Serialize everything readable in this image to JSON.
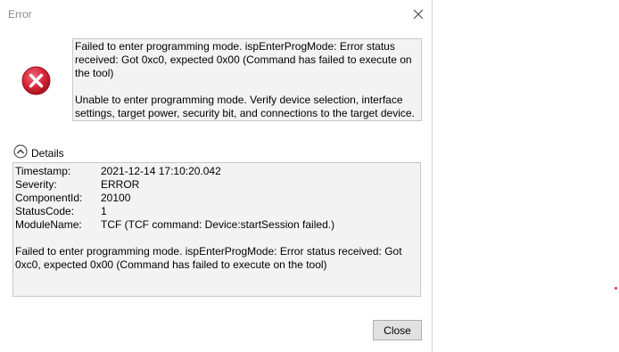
{
  "window": {
    "title": "Error"
  },
  "message": {
    "line1": "Failed to enter programming mode. ispEnterProgMode: Error status received: Got 0xc0, expected 0x00 (Command has failed to execute on the tool)",
    "line2": "Unable to enter programming mode. Verify device selection, interface settings, target power, security bit, and connections to the target device."
  },
  "details": {
    "toggle_label": "Details",
    "expanded": true,
    "fields": [
      {
        "key": "Timestamp:",
        "value": "2021-12-14 17:10:20.042"
      },
      {
        "key": "Severity:",
        "value": "ERROR"
      },
      {
        "key": "ComponentId:",
        "value": "20100"
      },
      {
        "key": "StatusCode:",
        "value": "1"
      },
      {
        "key": "ModuleName:",
        "value": "TCF (TCF command: Device:startSession failed.)"
      }
    ],
    "message": "Failed to enter programming mode. ispEnterProgMode: Error status received: Got 0xc0, expected 0x00 (Command has failed to execute on the tool)"
  },
  "buttons": {
    "close_label": "Close"
  },
  "icons": {
    "error": "error-circle-icon",
    "close": "close-icon",
    "details_toggle": "chevron-up-circle-icon"
  },
  "colors": {
    "error_red": "#d7273a",
    "panel_bg": "#f3f3f3",
    "button_bg": "#e1e1e1"
  }
}
